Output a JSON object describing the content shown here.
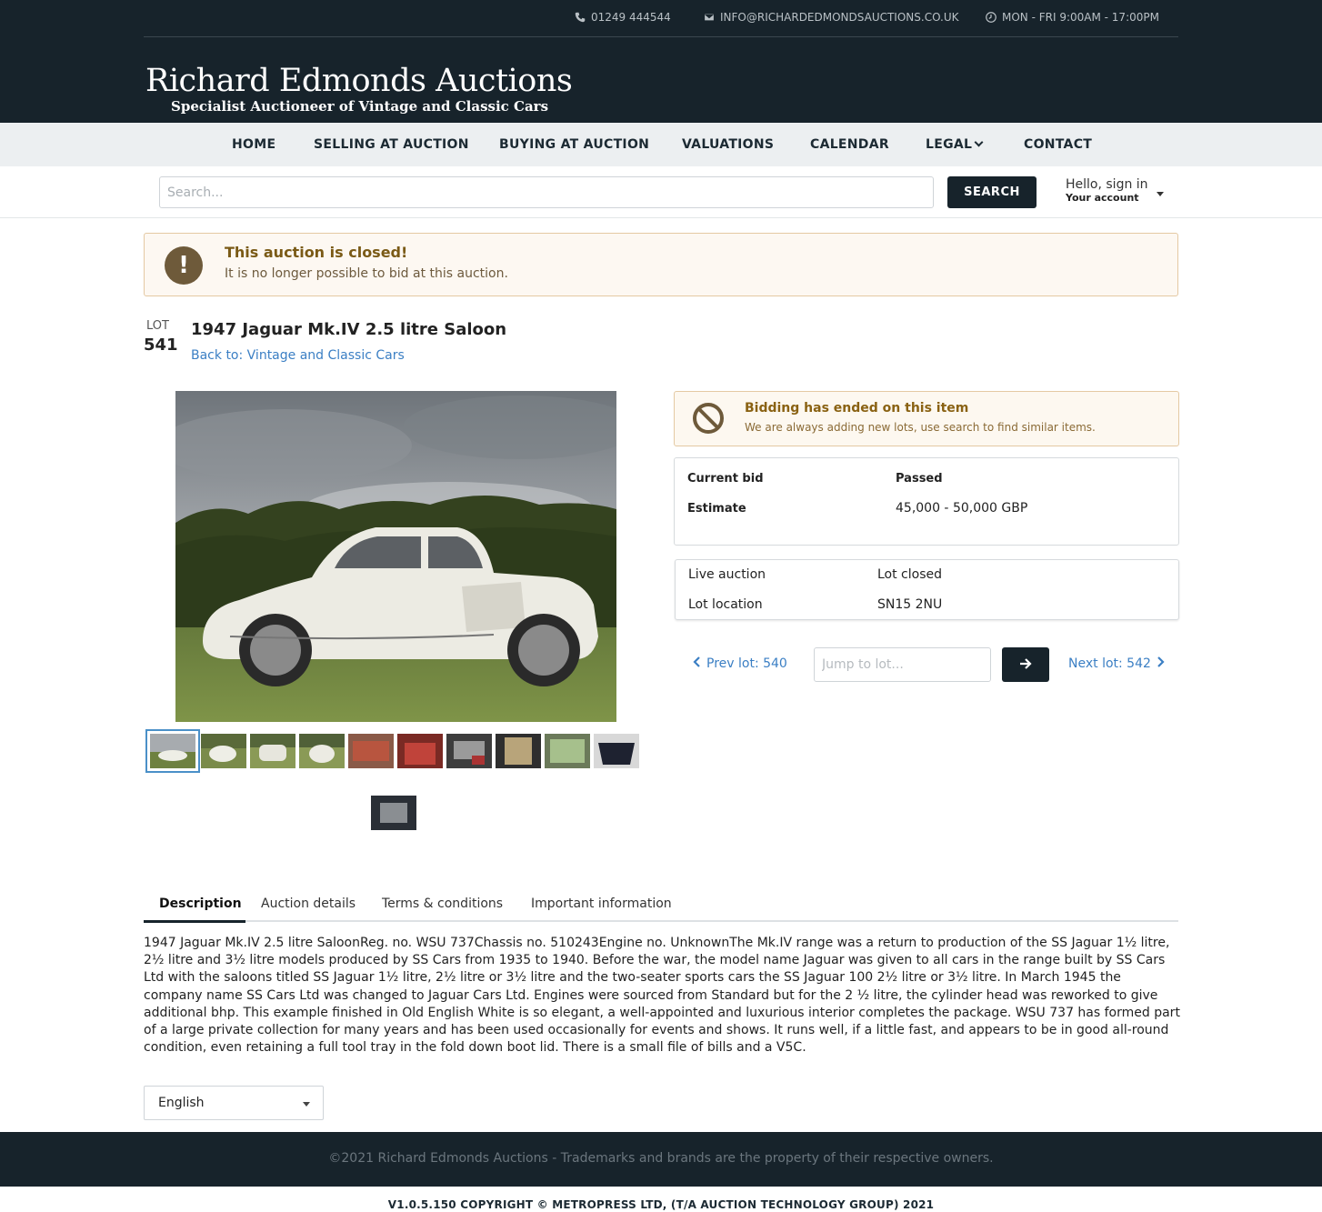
{
  "topbar": {
    "phone": "01249 444544",
    "email": "INFO@RICHARDEDMONDSAUCTIONS.CO.UK",
    "hours": "MON - FRI 9:00AM - 17:00PM"
  },
  "logo": {
    "title": "Richard Edmonds Auctions",
    "subtitle": "Specialist Auctioneer of Vintage and Classic Cars"
  },
  "nav": {
    "items": [
      "HOME",
      "SELLING AT AUCTION",
      "BUYING AT AUCTION",
      "VALUATIONS",
      "CALENDAR",
      "LEGAL",
      "CONTACT"
    ]
  },
  "search": {
    "placeholder": "Search...",
    "button": "SEARCH",
    "account_hello": "Hello, sign in",
    "account_sub": "Your account"
  },
  "alert": {
    "title": "This auction is closed!",
    "text": "It is no longer possible to bid at this auction."
  },
  "lot": {
    "label": "LOT",
    "number": "541",
    "title": "1947 Jaguar Mk.IV 2.5 litre Saloon",
    "back_link": "Back to: Vintage and Classic Cars"
  },
  "ended": {
    "title": "Bidding has ended on this item",
    "text": "We are always adding new lots, use search to find similar items."
  },
  "bid": {
    "current_label": "Current bid",
    "current_value": "Passed",
    "estimate_label": "Estimate",
    "estimate_value": "45,000 - 50,000 GBP"
  },
  "info": {
    "auction_label": "Live auction",
    "auction_value": "Lot closed",
    "location_label": "Lot location",
    "location_value": "SN15 2NU"
  },
  "lotnav": {
    "prev": "Prev lot: 540",
    "next": "Next lot: 542",
    "jump_placeholder": "Jump to lot..."
  },
  "tabs": [
    "Description",
    "Auction details",
    "Terms & conditions",
    "Important information"
  ],
  "description": "1947 Jaguar Mk.IV 2.5 litre SaloonReg. no. WSU 737Chassis no. 510243Engine no. UnknownThe Mk.IV range was a return to production of the SS Jaguar 1½ litre, 2½ litre and 3½ litre models produced by SS Cars from 1935 to 1940. Before the war, the model name Jaguar was given to all cars in the range built by SS Cars Ltd with the saloons titled SS Jaguar 1½ litre, 2½ litre or 3½ litre and the two-seater sports cars the SS Jaguar 100 2½ litre or 3½ litre. In March 1945 the company name SS Cars Ltd was changed to Jaguar Cars Ltd. Engines were sourced from Standard but for the 2 ½ litre, the cylinder head was reworked to give additional bhp. This example finished in Old English White is so elegant, a well-appointed and luxurious interior completes the package. WSU 737 has formed part of a large private collection for many years and has been used occasionally for events and shows. It runs well, if a little fast, and appears to be in good all-round condition, even retaining a full tool tray in the fold down boot lid. There is a small file of bills and a V5C.",
  "language": "English",
  "footer": "©2021 Richard Edmonds Auctions - Trademarks and brands are the property of their respective owners.",
  "copyright": "V1.0.5.150 COPYRIGHT © METROPRESS LTD, (T/A AUCTION TECHNOLOGY GROUP) 2021",
  "colors": {
    "header_bg": "#17232b",
    "nav_bg": "#eceff1",
    "link": "#3b7fc4",
    "alert_title": "#7a5a16"
  }
}
